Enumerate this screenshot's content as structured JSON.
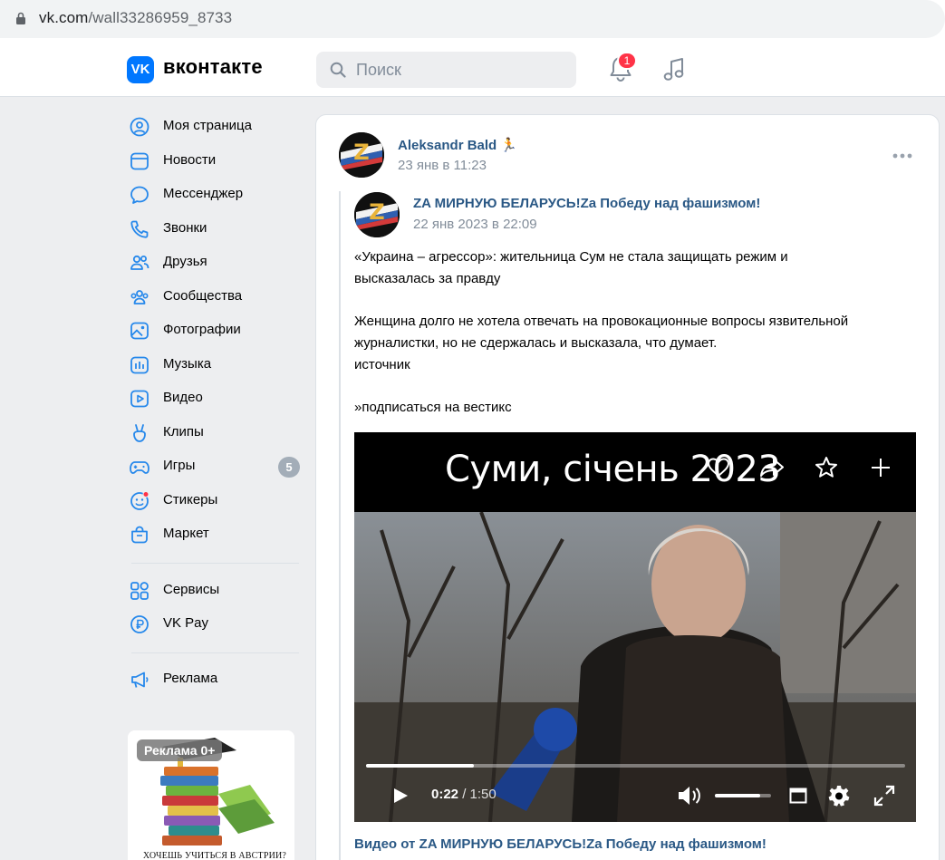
{
  "browser": {
    "url_host": "vk.com",
    "url_path": "/wall33286959_8733"
  },
  "header": {
    "logo_letters": "VK",
    "wordmark": "вконтакте",
    "search_placeholder": "Поиск",
    "notifications_count": "1"
  },
  "sidebar": {
    "items": [
      {
        "label": "Моя страница",
        "icon": "user-circle-icon"
      },
      {
        "label": "Новости",
        "icon": "newsfeed-icon"
      },
      {
        "label": "Мессенджер",
        "icon": "message-icon"
      },
      {
        "label": "Звонки",
        "icon": "phone-icon"
      },
      {
        "label": "Друзья",
        "icon": "friends-icon"
      },
      {
        "label": "Сообщества",
        "icon": "communities-icon"
      },
      {
        "label": "Фотографии",
        "icon": "photo-icon"
      },
      {
        "label": "Музыка",
        "icon": "music-icon"
      },
      {
        "label": "Видео",
        "icon": "video-icon"
      },
      {
        "label": "Клипы",
        "icon": "clips-icon"
      },
      {
        "label": "Игры",
        "icon": "gamepad-icon",
        "count": "5"
      },
      {
        "label": "Стикеры",
        "icon": "sticker-icon"
      },
      {
        "label": "Маркет",
        "icon": "market-bag-icon"
      },
      {
        "label": "Сервисы",
        "icon": "services-icon"
      },
      {
        "label": "VK Pay",
        "icon": "vkpay-icon"
      },
      {
        "label": "Реклама",
        "icon": "megaphone-icon"
      }
    ],
    "ad": {
      "badge": "Реклама 0+",
      "caption": "ХОЧЕШЬ УЧИТЬСЯ В АВСТРИИ?"
    }
  },
  "post": {
    "author": "Aleksandr Bald",
    "author_emoji": "🏃",
    "date": "23 янв в 11:23",
    "repost": {
      "group": "ZA МИРНУЮ БЕЛАРУСЬ!Za Победу над фашизмом!",
      "date": "22 янв 2023 в 22:09",
      "text_lines": [
        "«Украина – агрессор»: жительница Сум не стала защищать режим и",
        "высказалась за правду",
        "Женщина долго не хотела отвечать на провокационные вопросы язвительной",
        "журналистки, но не сдержалась и высказала, что думает.",
        "источник",
        "»подписаться на вестикс"
      ]
    },
    "video": {
      "overlay_title": "Суми, січень 2023",
      "current_time": "0:22",
      "duration": "1:50",
      "progress_fraction": 0.2,
      "volume_fraction": 0.8,
      "caption": "Видео от ZA МИРНУЮ БЕЛАРУСЬ!Za Победу над фашизмом!"
    }
  },
  "colors": {
    "vk_blue": "#0077ff",
    "link": "#2a5885",
    "icon": "#2688eb",
    "muted": "#818c99",
    "page_bg": "#edeef0",
    "badge_red": "#ff3347"
  }
}
